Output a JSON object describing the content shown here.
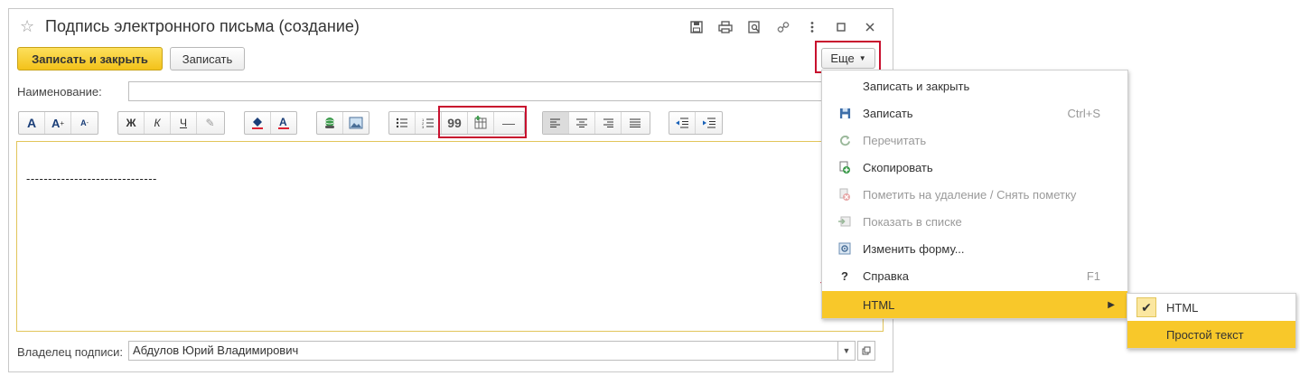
{
  "window": {
    "title": "Подпись электронного письма (создание)",
    "title_icons": [
      "save-icon",
      "print-icon",
      "preview-icon",
      "link-icon",
      "more-icon",
      "maximize-icon",
      "close-icon"
    ]
  },
  "toolbar": {
    "save_close_label": "Записать и закрыть",
    "save_label": "Записать",
    "more_label": "Еще"
  },
  "form": {
    "name_label": "Наименование:",
    "name_value": "",
    "owner_label": "Владелец подписи:",
    "owner_value": "Абдулов Юрий Владимирович"
  },
  "format_toolbar": {
    "font_buttons": [
      "A",
      "A",
      "A"
    ],
    "style_buttons": [
      "Ж",
      "К",
      "Ч",
      "✎"
    ],
    "quote_symbol": "99",
    "hr_symbol": "—"
  },
  "editor": {
    "content": "------------------------------"
  },
  "menu": {
    "items": [
      {
        "label": "Записать и закрыть",
        "shortcut": "",
        "icon": "",
        "disabled": false
      },
      {
        "label": "Записать",
        "shortcut": "Ctrl+S",
        "icon": "save-icon",
        "disabled": false
      },
      {
        "label": "Перечитать",
        "shortcut": "",
        "icon": "refresh-icon",
        "disabled": true
      },
      {
        "label": "Скопировать",
        "shortcut": "",
        "icon": "copy-icon",
        "disabled": false
      },
      {
        "label": "Пометить на удаление / Снять пометку",
        "shortcut": "",
        "icon": "delete-mark-icon",
        "disabled": true
      },
      {
        "label": "Показать в списке",
        "shortcut": "",
        "icon": "show-in-list-icon",
        "disabled": true
      },
      {
        "label": "Изменить форму...",
        "shortcut": "",
        "icon": "edit-form-icon",
        "disabled": false
      },
      {
        "label": "Справка",
        "shortcut": "F1",
        "icon": "help-icon",
        "disabled": false
      },
      {
        "label": "HTML",
        "shortcut": "",
        "icon": "",
        "disabled": false
      }
    ],
    "help_symbol": "?"
  },
  "submenu": {
    "items": [
      {
        "label": "HTML",
        "checked": true
      },
      {
        "label": "Простой текст",
        "checked": false
      }
    ]
  },
  "colors": {
    "accent_yellow": "#f8c82a",
    "highlight_red": "#c8102e"
  }
}
